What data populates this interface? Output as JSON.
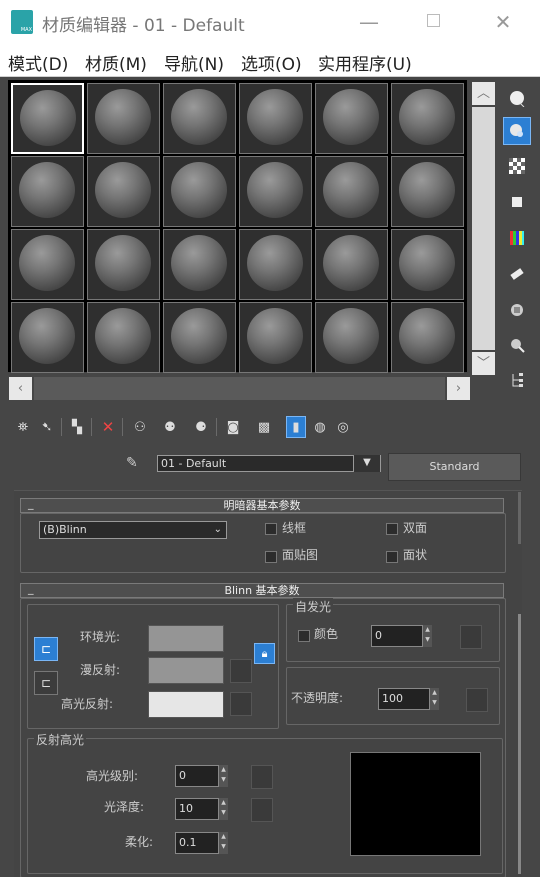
{
  "window": {
    "title": "材质编辑器 - 01 - Default",
    "logo_text": "MAX"
  },
  "menu": [
    "模式(D)",
    "材质(M)",
    "导航(N)",
    "选项(O)",
    "实用程序(U)"
  ],
  "material_name": "01 - Default",
  "material_type": "Standard",
  "shader_basic": {
    "header": "明暗器基本参数",
    "shader": "(B)Blinn",
    "options": [
      {
        "label": "线框",
        "checked": false
      },
      {
        "label": "双面",
        "checked": false
      },
      {
        "label": "面贴图",
        "checked": false
      },
      {
        "label": "面状",
        "checked": false
      }
    ]
  },
  "blinn_basic": {
    "header": "Blinn 基本参数",
    "ambient_label": "环境光:",
    "diffuse_label": "漫反射:",
    "specular_label": "高光反射:",
    "ambient_color": "#959595",
    "diffuse_color": "#959595",
    "specular_color": "#e6e6e6",
    "self_illum": {
      "title": "自发光",
      "color_label": "颜色",
      "value": "0"
    },
    "opacity": {
      "label": "不透明度:",
      "value": "100"
    },
    "spec_highlights": {
      "title": "反射高光",
      "level_label": "高光级别:",
      "level": "0",
      "gloss_label": "光泽度:",
      "gloss": "10",
      "soften_label": "柔化:",
      "soften": "0.1"
    }
  },
  "colors": {
    "accent": "#2c7fd3",
    "panel": "#464646",
    "highlight_bg": "#000000"
  }
}
